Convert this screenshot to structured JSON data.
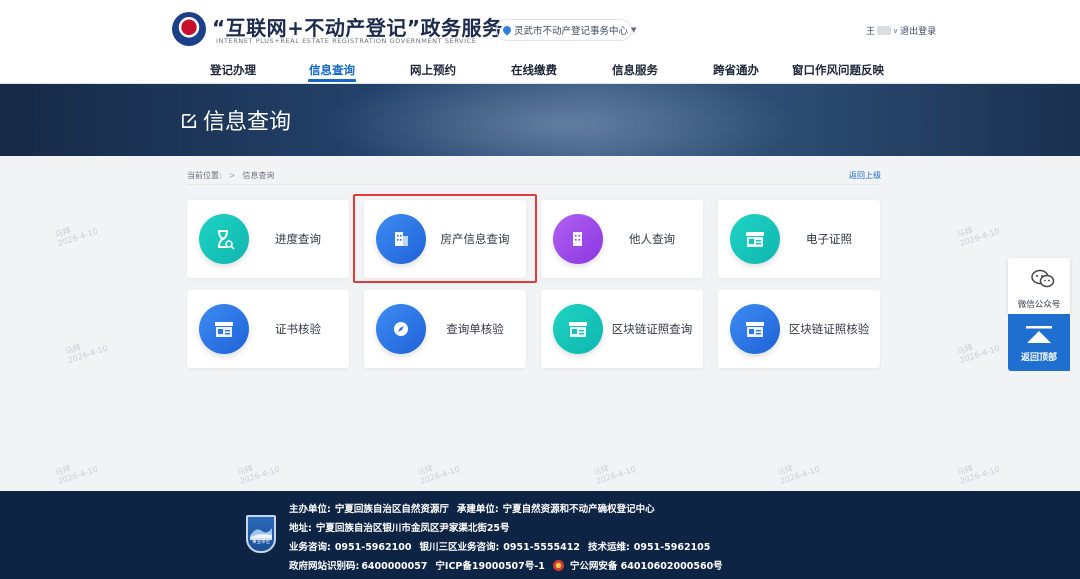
{
  "header": {
    "title": "“互联网+不动产登记”政务服务",
    "subtitle": "INTERNET PLUS+REAL ESTATE REGISTRATION GOVERNMENT SERVICE",
    "region": "灵武市不动产登记事务中心",
    "user_prefix": "王",
    "logout": "退出登录"
  },
  "nav": {
    "items": [
      "登记办理",
      "信息查询",
      "网上预约",
      "在线缴费",
      "信息服务",
      "跨省通办",
      "窗口作风问题反映"
    ],
    "active": "信息查询"
  },
  "banner": {
    "title": "信息查询"
  },
  "breadcrumb": {
    "label": "当前位置:",
    "current": "信息查询",
    "back": "返回上级"
  },
  "tiles": [
    {
      "label": "进度查询"
    },
    {
      "label": "房产信息查询"
    },
    {
      "label": "他人查询"
    },
    {
      "label": "电子证照"
    },
    {
      "label": "证书核验"
    },
    {
      "label": "查询单核验"
    },
    {
      "label": "区块链证照查询"
    },
    {
      "label": "区块链证照核验"
    }
  ],
  "watermark": {
    "name": "马拜",
    "date": "2026-4-10"
  },
  "side": {
    "wechat": "微信公众号",
    "totop": "返回顶部"
  },
  "footer": {
    "badge": "事业单位",
    "host_label": "主办单位:",
    "host": "宁夏回族自治区自然资源厅",
    "undertaker_label": "承建单位:",
    "undertaker": "宁夏自然资源和不动产确权登记中心",
    "address_label": "地址:",
    "address": "宁夏回族自治区银川市金凤区尹家渠北街25号",
    "consult_label": "业务咨询:",
    "consult_phone": "0951-5962100",
    "district_label": "银川三区业务咨询:",
    "district_phone": "0951-5555412",
    "tech_label": "技术运维:",
    "tech_phone": "0951-5962105",
    "site_code_label": "政府网站识别码:",
    "site_code": "6400000057",
    "icp": "宁ICP备19000507号-1",
    "police": "宁公网安备 64010602000560号"
  }
}
